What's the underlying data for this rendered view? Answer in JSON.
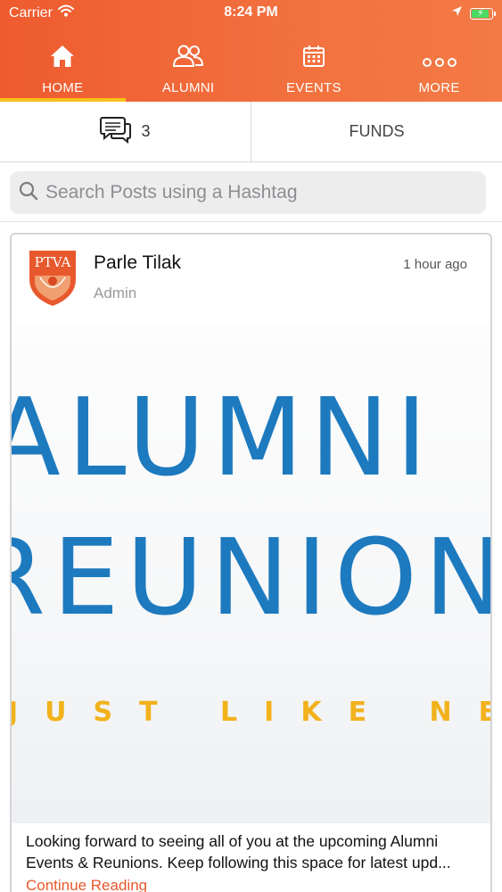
{
  "status_bar": {
    "carrier": "Carrier",
    "time": "8:24 PM",
    "battery_level": 0.85,
    "icons": [
      "wifi-icon",
      "location-arrow-icon",
      "battery-charging-icon"
    ]
  },
  "nav": {
    "tabs": [
      {
        "label": "HOME",
        "icon": "home-icon",
        "active": true
      },
      {
        "label": "ALUMNI",
        "icon": "users-icon",
        "active": false
      },
      {
        "label": "EVENTS",
        "icon": "calendar-icon",
        "active": false
      },
      {
        "label": "MORE",
        "icon": "more-dots-icon",
        "active": false
      }
    ]
  },
  "subtabs": {
    "messages_count": "3",
    "funds_label": "FUNDS"
  },
  "search": {
    "placeholder": "Search Posts using a Hashtag",
    "value": ""
  },
  "post": {
    "avatar_text": "PTVA",
    "author": "Parle Tilak",
    "role": "Admin",
    "time": "1 hour ago",
    "image_text": {
      "line1": "ALUMNI",
      "line2": "REUNION",
      "line3": "JUST LIKE NEW TIMES"
    },
    "text_line1": "Looking forward to seeing all of you at the upcoming Alumni",
    "text_line2": "Events & Reunions. Keep following this space for latest upd...",
    "continue_label": "Continue Reading"
  },
  "colors": {
    "brand_orange": "#ee5b2f",
    "active_indicator": "#f6c21a",
    "link": "#e8582d",
    "image_blue": "#1d7abf",
    "image_yellow": "#f2b21c"
  }
}
